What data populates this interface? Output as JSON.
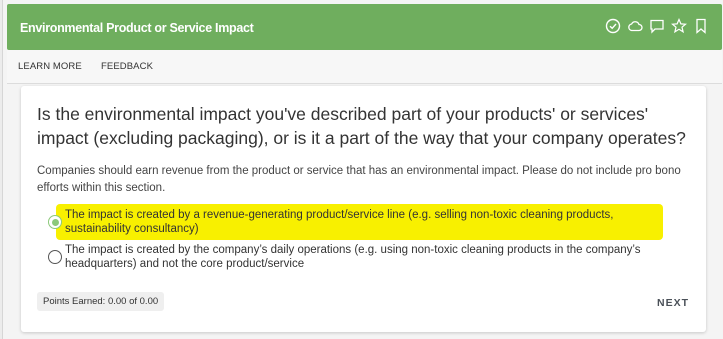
{
  "header": {
    "title": "Environmental Product or Service Impact",
    "icons": [
      "check-circle-icon",
      "cloud-icon",
      "comment-icon",
      "star-icon",
      "bookmark-icon"
    ]
  },
  "toolbar": {
    "learn_more": "LEARN MORE",
    "feedback": "FEEDBACK"
  },
  "question": {
    "text": "Is the environmental impact you've described part of your products' or services' impact (excluding packaging), or is it a part of the way that your company operates?",
    "helper": "Companies should earn revenue from the product or service that has an environmental impact. Please do not include pro bono efforts within this section."
  },
  "options": [
    {
      "label": "The impact is created by a revenue-generating product/service line (e.g. selling non-toxic cleaning products, sustainability consultancy)",
      "selected": true,
      "highlighted": true
    },
    {
      "label": "The impact is created by the company’s daily operations (e.g. using non-toxic cleaning products in the company’s headquarters) and not the core product/service",
      "selected": false,
      "highlighted": false
    }
  ],
  "footer": {
    "points": "Points Earned: 0.00 of 0.00",
    "next_label": "NEXT"
  },
  "colors": {
    "header_green": "#6fae5e",
    "radio_green": "#8cc97a",
    "highlight_yellow": "#f8f000"
  }
}
